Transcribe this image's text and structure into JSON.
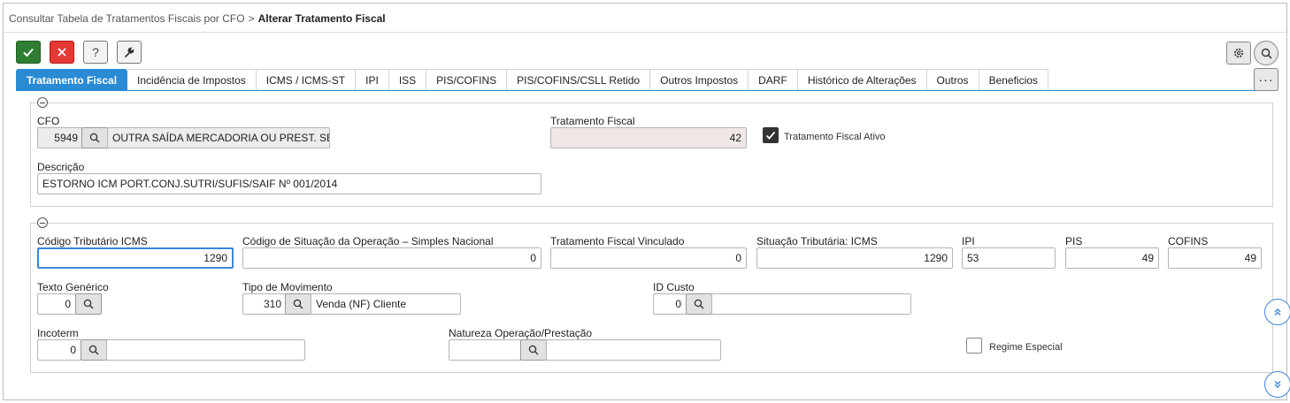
{
  "breadcrumb": {
    "parent": "Consultar Tabela de Tratamentos Fiscais por CFO",
    "separator": ">",
    "current": "Alterar Tratamento Fiscal"
  },
  "toolbar": {
    "confirm_icon": "check-icon",
    "cancel_icon": "close-icon",
    "help_label": "?",
    "tool_icon": "wrench-icon"
  },
  "tabs": [
    {
      "label": "Tratamento Fiscal",
      "active": true
    },
    {
      "label": "Incidência de Impostos"
    },
    {
      "label": "ICMS / ICMS-ST"
    },
    {
      "label": "IPI"
    },
    {
      "label": "ISS"
    },
    {
      "label": "PIS/COFINS"
    },
    {
      "label": "PIS/COFINS/CSLL Retido"
    },
    {
      "label": "Outros Impostos"
    },
    {
      "label": "DARF"
    },
    {
      "label": "Histórico de Alterações"
    },
    {
      "label": "Outros"
    },
    {
      "label": "Beneficios"
    }
  ],
  "more_label": "···",
  "section1": {
    "cfo_label": "CFO",
    "cfo_code": "5949",
    "cfo_description": "OUTRA SAÍDA MERCADORIA OU PREST. SERVIÇO",
    "tratamento_label": "Tratamento Fiscal",
    "tratamento_value": "42",
    "ativo_label": "Tratamento Fiscal Ativo",
    "ativo_checked": true,
    "descricao_label": "Descrição",
    "descricao_value": "ESTORNO ICM PORT.CONJ.SUTRI/SUFIS/SAIF Nº 001/2014"
  },
  "section2": {
    "cod_trib_label": "Código Tributário ICMS",
    "cod_trib_value": "1290",
    "csosn_label": "Código de Situação da Operação – Simples Nacional",
    "csosn_value": "0",
    "vinculado_label": "Tratamento Fiscal Vinculado",
    "vinculado_value": "0",
    "sit_trib_label": "Situação Tributária: ICMS",
    "sit_trib_value": "1290",
    "ipi_label": "IPI",
    "ipi_value": "53",
    "pis_label": "PIS",
    "pis_value": "49",
    "cofins_label": "COFINS",
    "cofins_value": "49",
    "texto_label": "Texto Genérico",
    "texto_value": "0",
    "movimento_label": "Tipo de Movimento",
    "movimento_code": "310",
    "movimento_desc": "Venda (NF) Cliente",
    "custo_label": "ID Custo",
    "custo_value": "0",
    "incoterm_label": "Incoterm",
    "incoterm_value": "0",
    "natureza_label": "Natureza Operação/Prestação",
    "natureza_value": "",
    "regime_label": "Regime Especial",
    "regime_checked": false
  },
  "colors": {
    "accent": "#2a8ad4",
    "confirm": "#2e7d32",
    "cancel": "#e53935"
  }
}
